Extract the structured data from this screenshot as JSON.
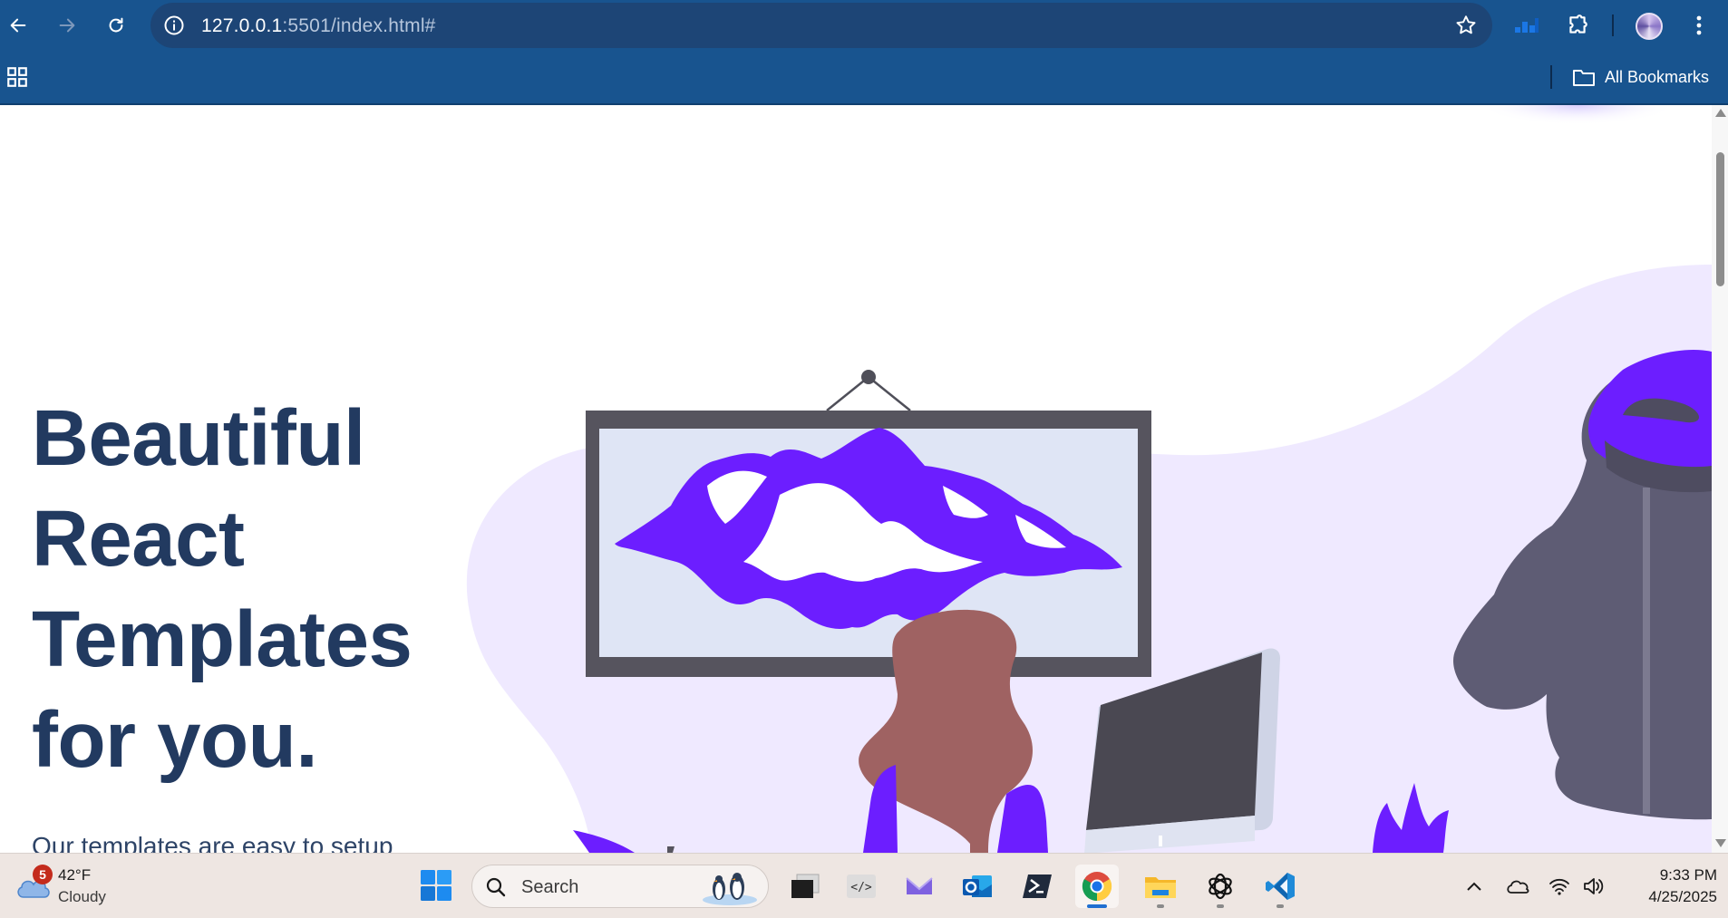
{
  "browser": {
    "url_host": "127.0.0.1",
    "url_rest": ":5501/index.html#",
    "bookmarks_label": "All Bookmarks"
  },
  "page": {
    "hero_title": "Beautiful\nReact\nTemplates\nfor you.",
    "hero_subtitle": "Our templates are easy to setup"
  },
  "taskbar": {
    "weather_badge": "5",
    "temperature": "42°F",
    "condition": "Cloudy",
    "search_label": "Search",
    "time": "9:33 PM",
    "date": "4/25/2025"
  },
  "colors": {
    "browser_bar": "#18548f",
    "title_text": "#223a60",
    "accent_purple": "#6c1eff",
    "blob_lavender": "#efe9ff",
    "taskbar_bg": "#eee6e2"
  },
  "icons": [
    "back-arrow-icon",
    "forward-arrow-icon",
    "reload-icon",
    "site-info-icon",
    "bookmark-star-icon",
    "extension-meter-icon",
    "extensions-puzzle-icon",
    "profile-avatar",
    "menu-dots-icon",
    "apps-grid-icon",
    "folder-icon",
    "windows-start-icon",
    "search-icon",
    "terminal-icon",
    "code-icon",
    "mail-icon",
    "outlook-icon",
    "powershell-icon",
    "chrome-icon",
    "file-explorer-icon",
    "chatgpt-icon",
    "vscode-icon",
    "chevron-up-icon",
    "onedrive-cloud-icon",
    "wifi-icon",
    "volume-icon"
  ]
}
